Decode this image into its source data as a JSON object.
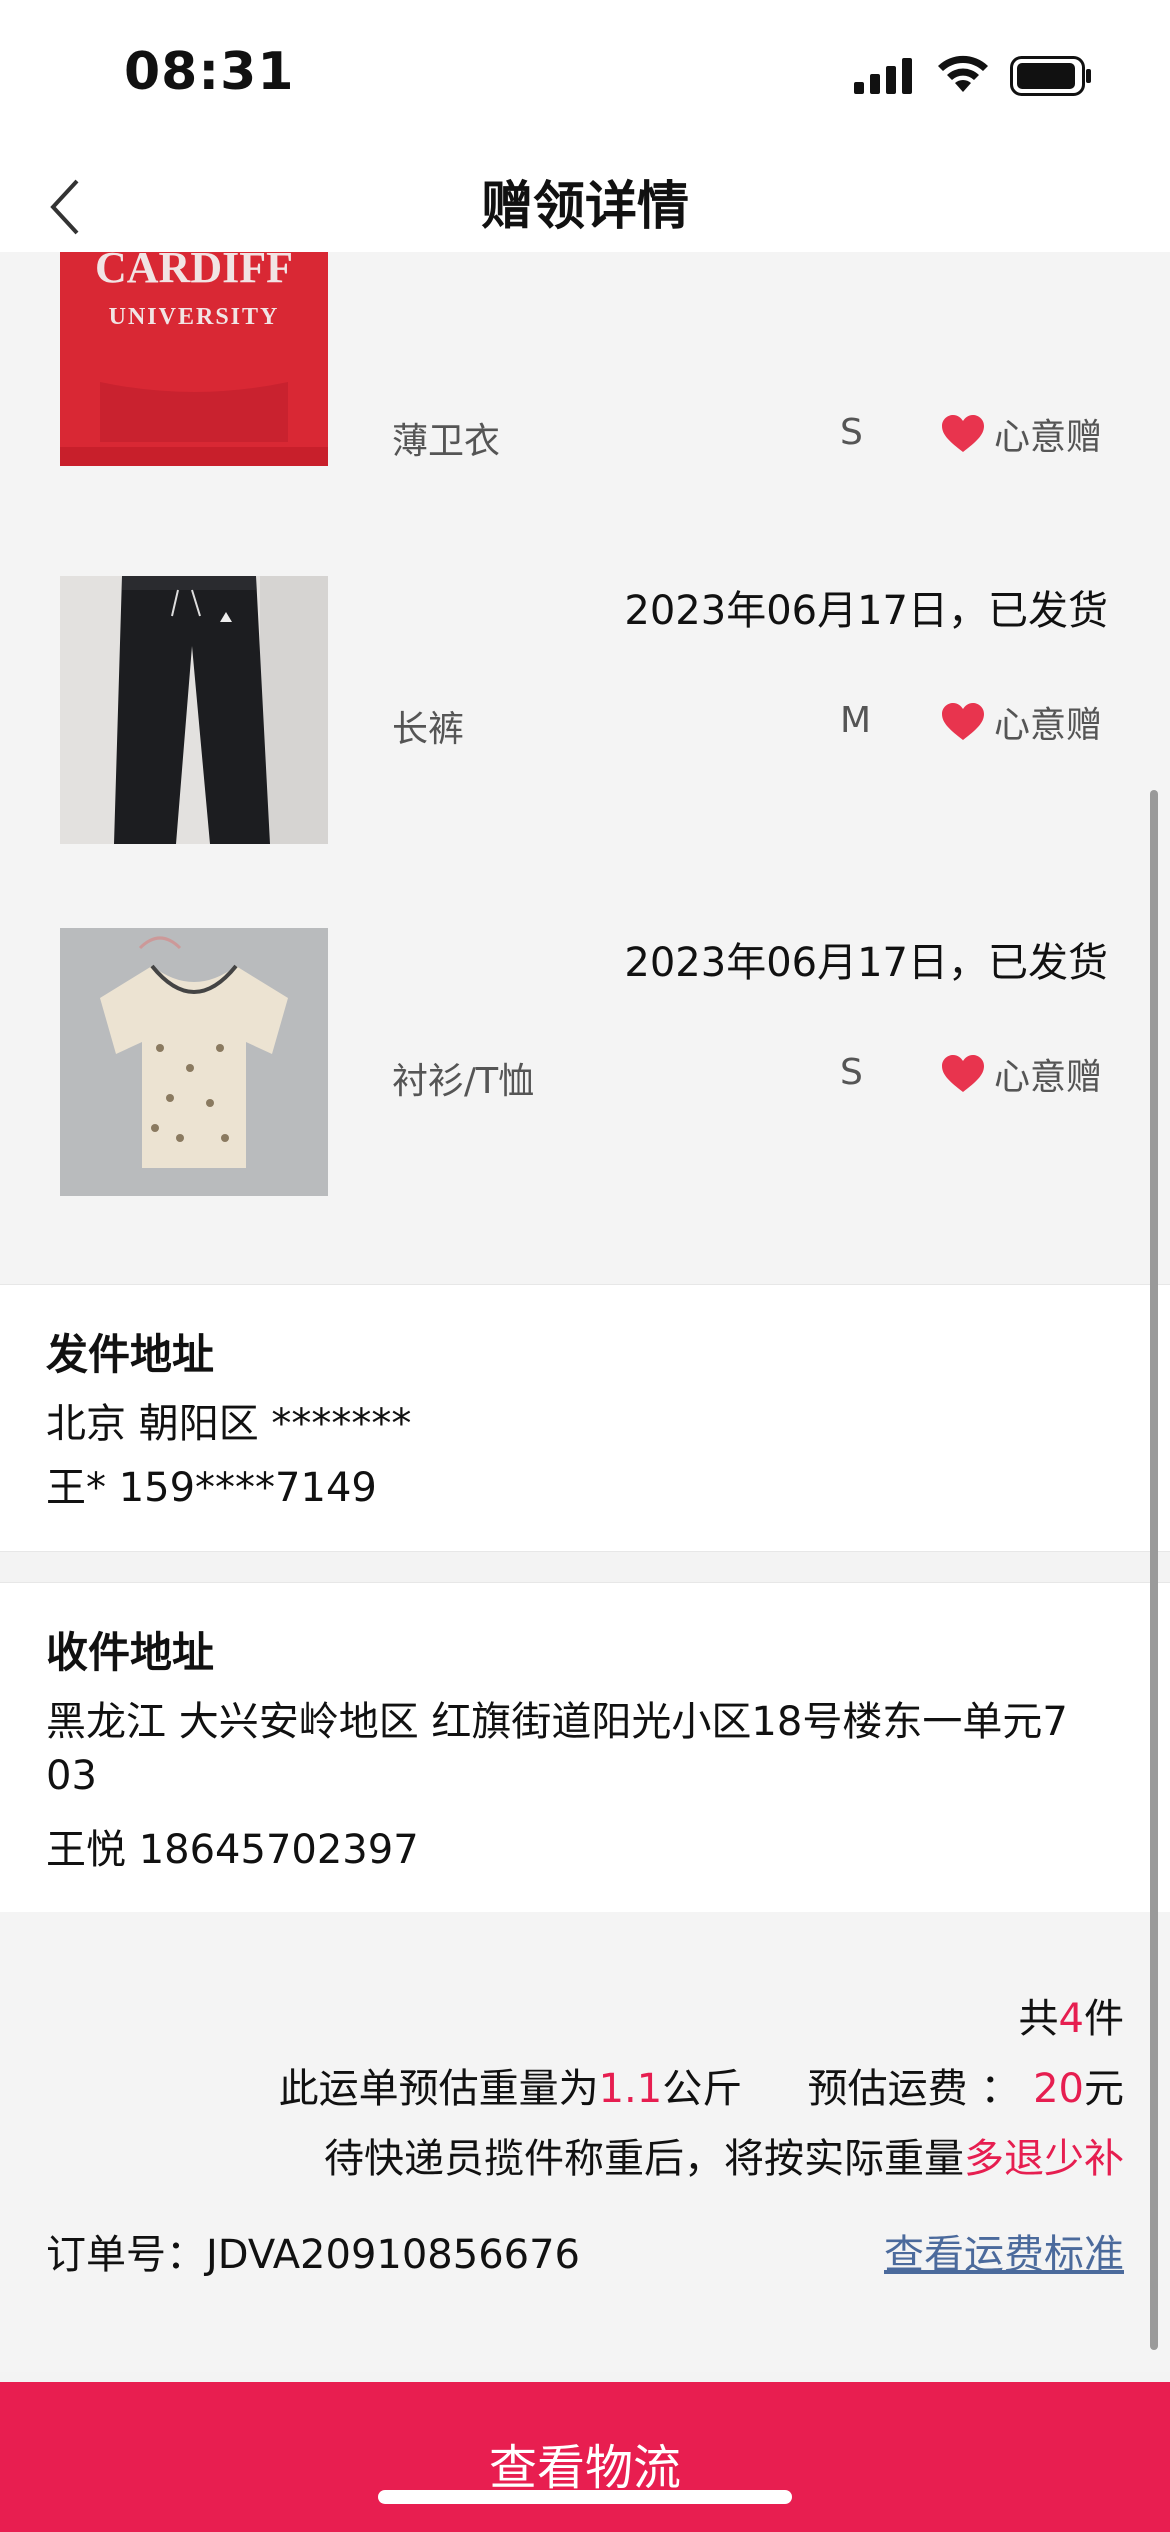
{
  "status": {
    "time": "08:31"
  },
  "nav": {
    "title": "赠领详情"
  },
  "items": [
    {
      "date": "",
      "name": "薄卫衣",
      "size": "S",
      "type": "心意赠"
    },
    {
      "date": "2023年06月17日，已发货",
      "name": "长裤",
      "size": "M",
      "type": "心意赠"
    },
    {
      "date": "2023年06月17日，已发货",
      "name": "衬衫/T恤",
      "size": "S",
      "type": "心意赠"
    }
  ],
  "sender": {
    "title": "发件地址",
    "address": "北京 朝阳区 *******",
    "contact": "王* 159****7149"
  },
  "receiver": {
    "title": "收件地址",
    "address_line1": "黑龙江 大兴安岭地区 红旗街道阳光小区18号楼东一单元7",
    "address_line2": "03",
    "contact": "王悦 18645702397"
  },
  "summary": {
    "count_prefix": "共",
    "count": "4",
    "count_suffix": "件",
    "weight_prefix": "此运单预估重量为",
    "weight": "1.1",
    "weight_unit": "公斤",
    "fee_prefix": "预估运费 ：",
    "fee": "20",
    "fee_unit": "元",
    "note_prefix": "待快递员揽件称重后，将按实际重量",
    "note_highlight": "多退少补",
    "order_label": "订单号：JDVA20910856676",
    "fee_standard_link": "查看运费标准"
  },
  "bottom_button": {
    "label": "查看物流"
  },
  "colors": {
    "accent": "#e81e50",
    "heart": "#e8344e",
    "link": "#4b6a9c"
  }
}
